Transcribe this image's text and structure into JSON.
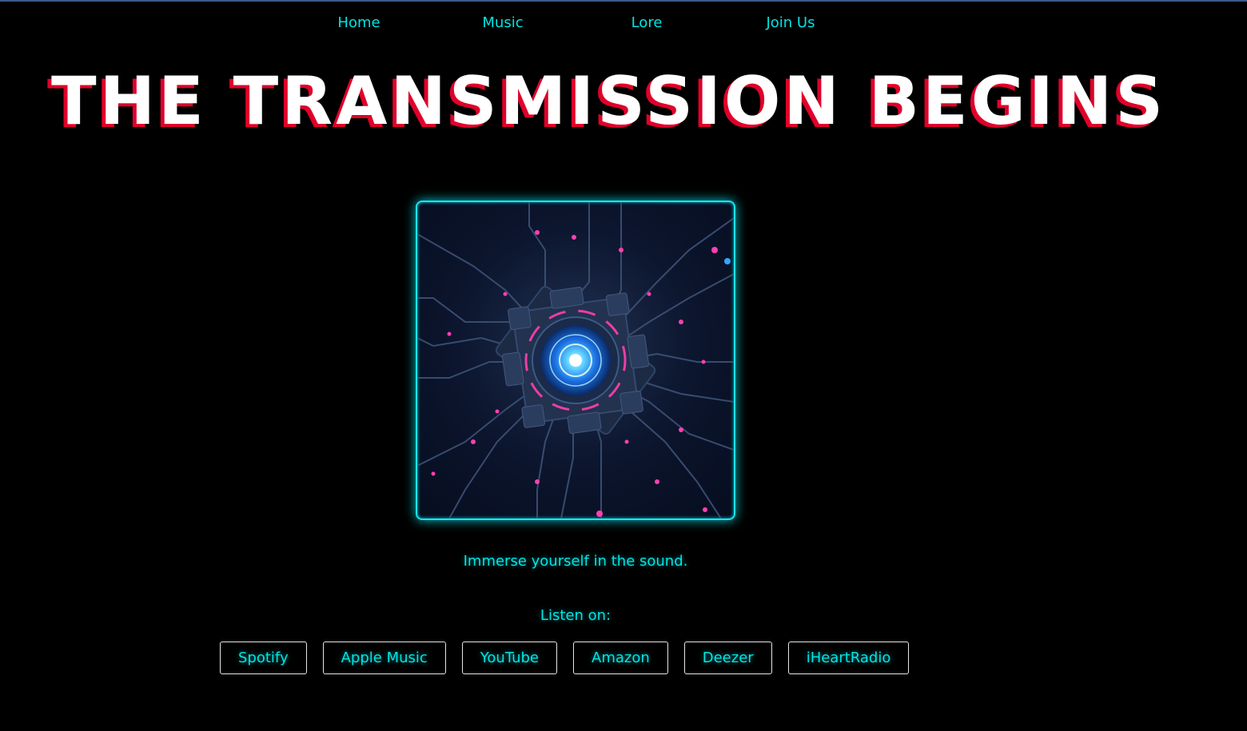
{
  "nav": {
    "items": [
      {
        "label": "Home"
      },
      {
        "label": "Music"
      },
      {
        "label": "Lore"
      },
      {
        "label": "Join Us"
      }
    ]
  },
  "hero": {
    "title": "THE TRANSMISSION BEGINS"
  },
  "artwork": {
    "description_icon": "glowing-circuit-core-icon"
  },
  "tagline": "Immerse yourself in the sound.",
  "listen": {
    "label": "Listen on:",
    "platforms": [
      {
        "label": "Spotify"
      },
      {
        "label": "Apple Music"
      },
      {
        "label": "YouTube"
      },
      {
        "label": "Amazon"
      },
      {
        "label": "Deezer"
      },
      {
        "label": "iHeartRadio"
      }
    ]
  },
  "colors": {
    "background": "#000000",
    "accent_cyan": "#00e5e5",
    "title_white": "#ffffff",
    "title_shadow_red": "#e0002a",
    "circuit_pink": "#ff3fb0",
    "core_blue": "#2fa8ff"
  }
}
